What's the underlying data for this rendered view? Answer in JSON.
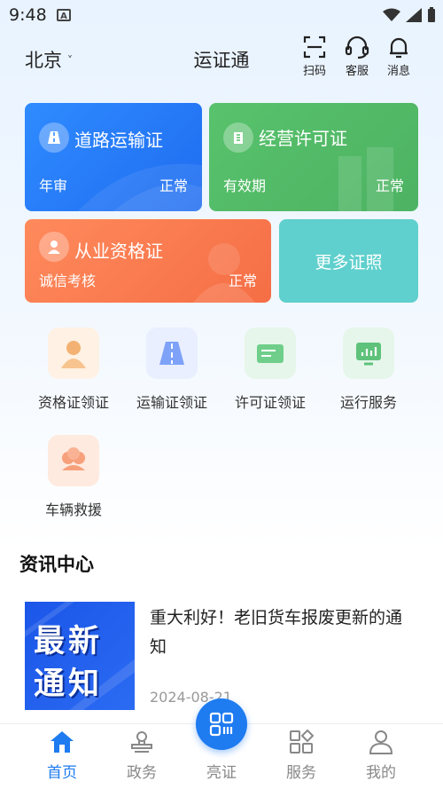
{
  "status_bar": {
    "time": "9:48"
  },
  "header": {
    "city": "北京",
    "title": "运证通",
    "scan_label": "扫码",
    "support_label": "客服",
    "message_label": "消息"
  },
  "cards": {
    "road": {
      "title": "道路运输证",
      "left": "年审",
      "right": "正常"
    },
    "biz": {
      "title": "经营许可证",
      "left": "有效期",
      "right": "正常"
    },
    "cert": {
      "title": "从业资格证",
      "left": "诚信考核",
      "right": "正常"
    },
    "more": {
      "label": "更多证照"
    }
  },
  "services": [
    {
      "label": "资格证领证",
      "icon": "person-certificate-icon",
      "color": "#fff1e3"
    },
    {
      "label": "运输证领证",
      "icon": "road-icon",
      "color": "#e9efff"
    },
    {
      "label": "许可证领证",
      "icon": "license-card-icon",
      "color": "#e6f6ea"
    },
    {
      "label": "运行服务",
      "icon": "monitor-chart-icon",
      "color": "#e6f6ea"
    },
    {
      "label": "车辆救援",
      "icon": "rescue-icon",
      "color": "#ffeadf"
    }
  ],
  "news": {
    "heading": "资讯中心",
    "items": [
      {
        "image_text_1": "最新",
        "image_text_2": "通知",
        "title": "重大利好！老旧货车报废更新的通知",
        "date": "2024-08-21"
      }
    ]
  },
  "bottom_nav": [
    {
      "label": "首页",
      "active": true
    },
    {
      "label": "政务",
      "active": false
    },
    {
      "label": "亮证",
      "active": false
    },
    {
      "label": "服务",
      "active": false
    },
    {
      "label": "我的",
      "active": false
    }
  ],
  "colors": {
    "primary": "#1e7bf0",
    "road_card": "#2f8bff",
    "biz_card": "#58c26c",
    "cert_card": "#f56e45",
    "more_card": "#5fd0cd"
  }
}
